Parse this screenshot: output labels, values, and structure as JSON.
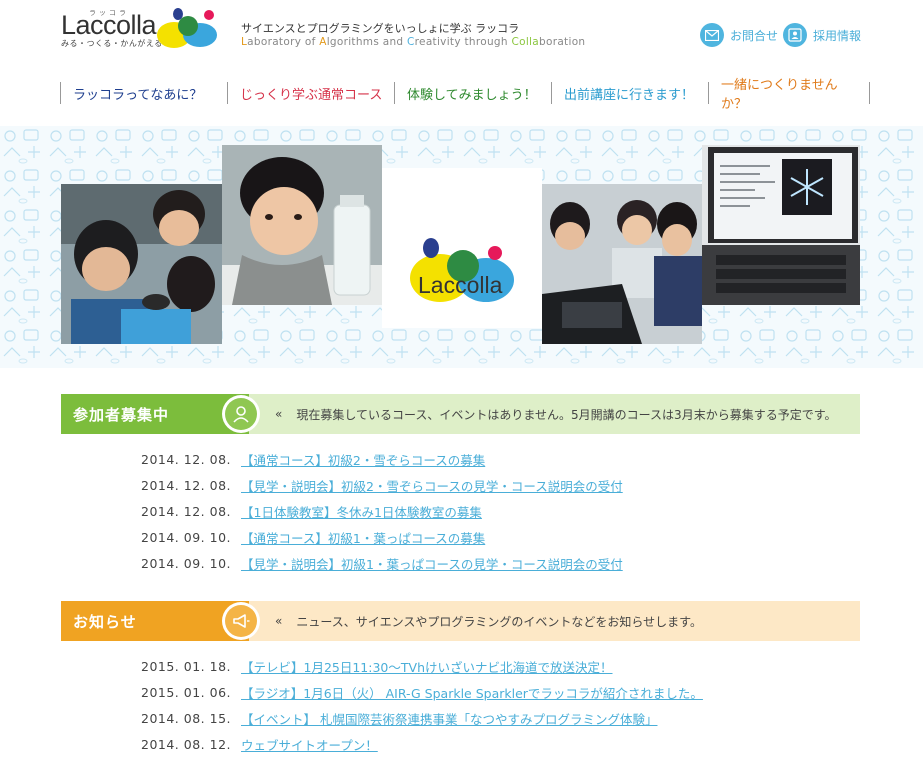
{
  "header": {
    "logo_text": "Laccolla",
    "logo_ruby": "ラッコラ",
    "logo_sub": "みる・つくる・かんがえる",
    "tagline_jp": "サイエンスとプログラミングをいっしょに学ぶ ラッコラ",
    "tagline_en": {
      "p1": "L",
      "p2": "aboratory of ",
      "p3": "A",
      "p4": "lgorithms and ",
      "p5": "C",
      "p6": "reativity through ",
      "p7": "Colla",
      "p8": "boration"
    },
    "contact_label": "お問合せ",
    "recruit_label": "採用情報"
  },
  "nav": [
    {
      "label": "ラッコラってなあに？",
      "color": "#1f3f8f"
    },
    {
      "label": "じっくり学ぶ通常コース",
      "color": "#d6334a"
    },
    {
      "label": "体験してみましょう！",
      "color": "#2f8a2f"
    },
    {
      "label": "出前講座に行きます！",
      "color": "#2b9ccf"
    },
    {
      "label": "一緒につくりませんか？",
      "color": "#e07b1b"
    }
  ],
  "hero": {
    "logo_text": "Laccolla"
  },
  "recruit": {
    "label": "参加者募集中",
    "color": "#7cbd3c",
    "msg_bg": "#deefc8",
    "marker": "«",
    "message": "現在募集しているコース、イベントはありません。5月開講のコースは3月末から募集する予定です。",
    "items": [
      {
        "date": "2014. 12. 08.",
        "title": "【通常コース】初級2・雪ぞらコースの募集"
      },
      {
        "date": "2014. 12. 08.",
        "title": "【見学・説明会】初級2・雪ぞらコースの見学・コース説明会の受付"
      },
      {
        "date": "2014. 12. 08.",
        "title": "【1日体験教室】冬休み1日体験教室の募集"
      },
      {
        "date": "2014. 09. 10.",
        "title": "【通常コース】初級1・葉っぱコースの募集"
      },
      {
        "date": "2014. 09. 10.",
        "title": "【見学・説明会】初級1・葉っぱコースの見学・コース説明会の受付"
      }
    ]
  },
  "news": {
    "label": "お知らせ",
    "color": "#f0a322",
    "msg_bg": "#fde8c6",
    "marker": "«",
    "message": "ニュース、サイエンスやプログラミングのイベントなどをお知らせします。",
    "items": [
      {
        "date": "2015. 01. 18.",
        "title": "【テレビ】1月25日11:30～TVhけいざいナビ北海道で放送決定！"
      },
      {
        "date": "2015. 01. 06.",
        "title": "【ラジオ】1月6日（火） AIR-G Sparkle Sparklerでラッコラが紹介されました。"
      },
      {
        "date": "2014. 08. 15.",
        "title": "【イベント】 札幌国際芸術祭連携事業「なつやすみプログラミング体験」"
      },
      {
        "date": "2014. 08. 12.",
        "title": "ウェブサイトオープン！"
      }
    ]
  },
  "brand_colors": {
    "navy": "#2a3f8f",
    "green": "#2e8b43",
    "magenta": "#e6195a",
    "yellow": "#f4e100",
    "blue": "#3aa6dd"
  }
}
